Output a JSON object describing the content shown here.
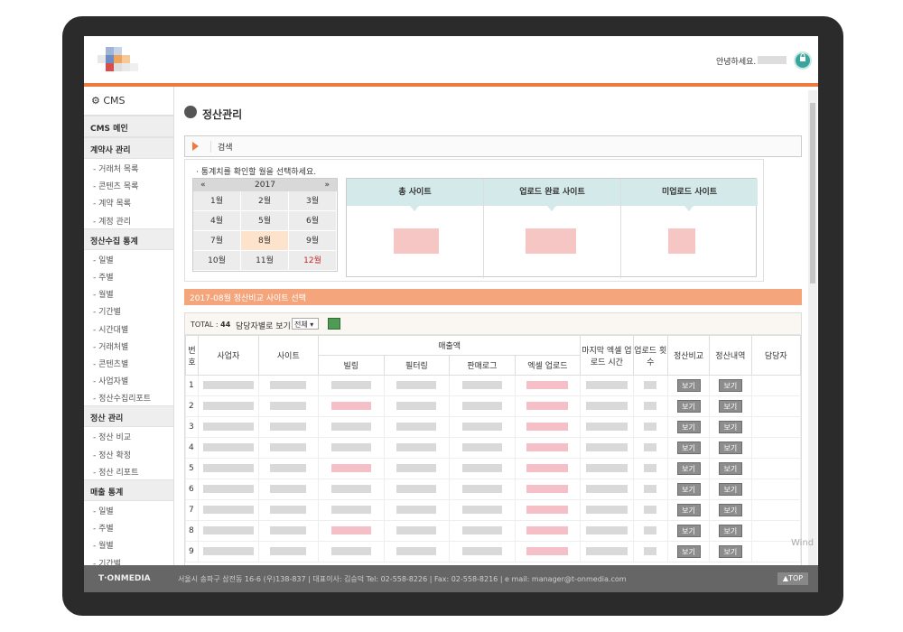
{
  "header": {
    "greeting": "안녕하세요.",
    "lock_icon": "lock-icon"
  },
  "sidebar": {
    "title": "CMS",
    "sections": [
      {
        "label": "CMS 메인",
        "items": []
      },
      {
        "label": "계약사 관리",
        "items": [
          "- 거래처 목록",
          "- 콘텐츠 목록",
          "- 계약 목록",
          "- 계정 관리"
        ]
      },
      {
        "label": "정산수집 통계",
        "items": [
          "- 일별",
          "- 주별",
          "- 월별",
          "- 기간별",
          "- 시간대별",
          "- 거래처별",
          "- 콘텐츠별",
          "- 사업자별",
          "- 정산수집리포트"
        ]
      },
      {
        "label": "정산 관리",
        "items": [
          "- 정산 비교",
          "- 정산 확정",
          "- 정산 리포트"
        ]
      },
      {
        "label": "매출 통계",
        "items": [
          "- 일별",
          "- 주별",
          "- 월별",
          "- 기간별"
        ]
      }
    ]
  },
  "main": {
    "page_title": "정산관리",
    "search_label": "검색",
    "note": "· 통계치를 확인할 월을 선택하세요.",
    "calendar": {
      "prev": "«",
      "year": "2017",
      "next": "»",
      "months": [
        "1월",
        "2월",
        "3월",
        "4월",
        "5월",
        "6월",
        "7월",
        "8월",
        "9월",
        "10월",
        "11월",
        "12월"
      ],
      "selected": "8월",
      "highlight": "12월"
    },
    "stats": [
      "총 사이트",
      "업로드 완료 사이트",
      "미업로드 사이트"
    ],
    "section_bar": "2017-08월 정산비교 사이트 선택",
    "table_bar": {
      "total_label": "TOTAL : ",
      "total_value": "44",
      "by_manager": "담당자별로 보기 :",
      "select_value": "전체"
    },
    "table": {
      "headers": {
        "no": "번호",
        "company": "사업자",
        "site": "사이트",
        "sales": "매출액",
        "billing": "빌링",
        "filtering": "필터링",
        "sales_log": "판매로그",
        "excel_upload": "엑셀 업로드",
        "last_upload_time": "마지막 엑셀 업로드 시간",
        "upload_count": "업로드 횟수",
        "compare": "정산비교",
        "detail": "정산내역",
        "manager": "담당자"
      },
      "rows": [
        "1",
        "2",
        "3",
        "4",
        "5",
        "6",
        "7",
        "8",
        "9"
      ],
      "view_label": "보기"
    }
  },
  "footer": {
    "brand": "T·ONMEDIA",
    "address": "서울시 송파구 삼전동 16-6 (우)138-837 | 대표이사: 김승덕 Tel: 02-558-8226 | Fax: 02-558-8216 | e mail: manager@t-onmedia.com",
    "top_label": "▲TOP"
  },
  "watermark": "Wind"
}
